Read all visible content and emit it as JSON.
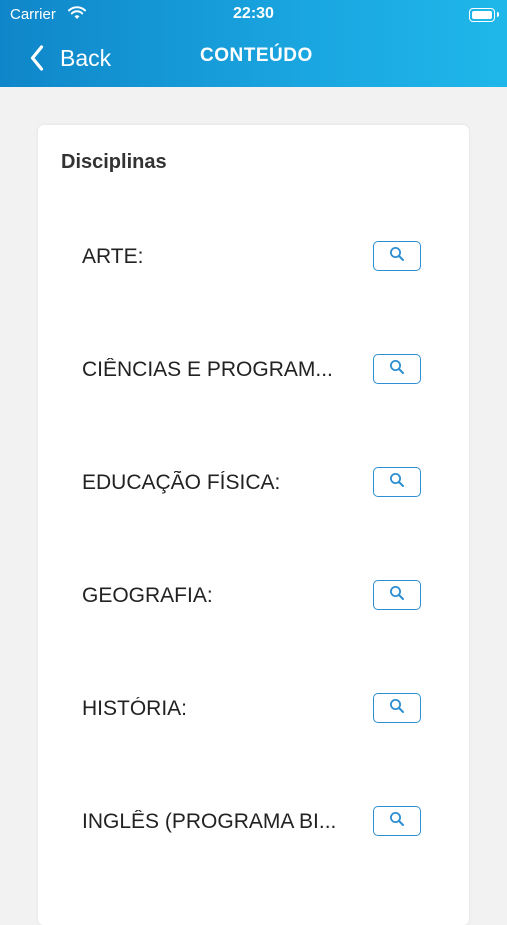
{
  "status_bar": {
    "carrier": "Carrier",
    "time": "22:30"
  },
  "nav": {
    "back_label": "Back",
    "title": "CONTEÚDO"
  },
  "card": {
    "section_title": "Disciplinas",
    "subjects": [
      {
        "label": "ARTE:"
      },
      {
        "label": "CIÊNCIAS E PROGRAM..."
      },
      {
        "label": "EDUCAÇÃO FÍSICA:"
      },
      {
        "label": "GEOGRAFIA:"
      },
      {
        "label": "HISTÓRIA:"
      },
      {
        "label": "INGLÊS (PROGRAMA BI..."
      }
    ]
  },
  "colors": {
    "header_start": "#0f86c9",
    "header_end": "#1fb7ea",
    "accent": "#2d8fd1",
    "background": "#f2f2f2"
  },
  "icons": {
    "back": "chevron-left-icon",
    "search": "search-icon",
    "wifi": "wifi-icon",
    "battery": "battery-icon"
  }
}
